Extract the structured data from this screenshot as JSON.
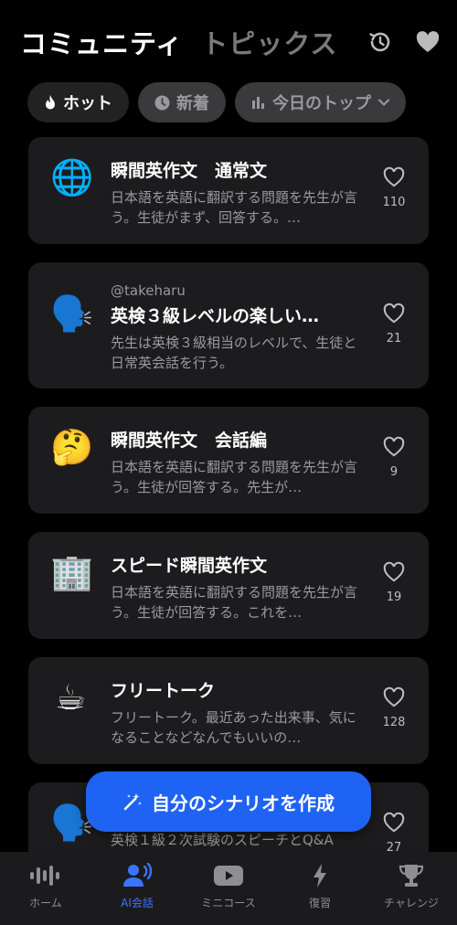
{
  "header": {
    "title": "コミュニティ",
    "subtitle": "トピックス"
  },
  "filters": [
    {
      "label": "ホット",
      "icon": "flame-icon"
    },
    {
      "label": "新着",
      "icon": "clock-icon"
    },
    {
      "label": "今日のトップ",
      "icon": "bar-chart-icon"
    }
  ],
  "topics": [
    {
      "emoji": "🌐",
      "author": "",
      "title": "瞬間英作文　通常文",
      "desc": "日本語を英語に翻訳する問題を先生が言う。生徒がまず、回答する。…",
      "likes": "110"
    },
    {
      "emoji": "🗣️",
      "author": "@takeharu",
      "title": "英検３級レベルの楽しい…",
      "desc": "先生は英検３級相当のレベルで、生徒と日常英会話を行う。",
      "likes": "21"
    },
    {
      "emoji": "🤔",
      "author": "",
      "title": "瞬間英作文　会話編",
      "desc": "日本語を英語に翻訳する問題を先生が言う。生徒が回答する。先生が…",
      "likes": "9"
    },
    {
      "emoji": "🏢",
      "author": "",
      "title": "スピード瞬間英作文",
      "desc": "日本語を英語に翻訳する問題を先生が言う。生徒が回答する。これを…",
      "likes": "19"
    },
    {
      "emoji": "☕",
      "author": "",
      "title": "フリートーク",
      "desc": "フリートーク。最近あった出来事、気になることなどなんでもいいの…",
      "likes": "128"
    },
    {
      "emoji": "🗣️",
      "author": "",
      "title": "",
      "desc": "英検１級２次試験のスピーチとQ&A",
      "likes": "27"
    }
  ],
  "fab": {
    "label": "自分のシナリオを作成"
  },
  "tabs": [
    {
      "label": "ホーム",
      "icon": "waveform-icon"
    },
    {
      "label": "AI会話",
      "icon": "people-icon"
    },
    {
      "label": "ミニコース",
      "icon": "play-icon"
    },
    {
      "label": "復習",
      "icon": "bolt-icon"
    },
    {
      "label": "チャレンジ",
      "icon": "trophy-icon"
    }
  ],
  "colors": {
    "accent": "#1f63f5",
    "tab_active": "#3b74ff",
    "card_bg": "#1c1c1e"
  }
}
